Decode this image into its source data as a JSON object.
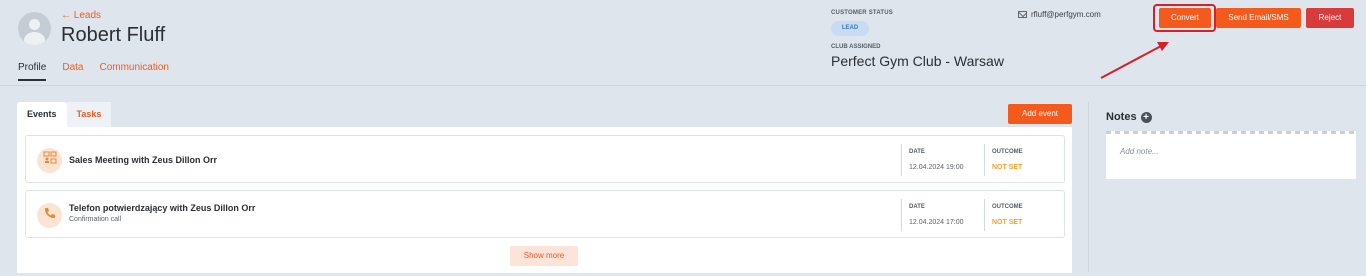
{
  "header": {
    "back_link": "← Leads",
    "name": "Robert Fluff",
    "tabs": [
      {
        "label": "Profile",
        "active": true
      },
      {
        "label": "Data",
        "active": false
      },
      {
        "label": "Communication",
        "active": false
      }
    ],
    "customer_status_label": "CUSTOMER STATUS",
    "customer_status_value": "LEAD",
    "club_assigned_label": "CLUB ASSIGNED",
    "club_name": "Perfect Gym Club - Warsaw",
    "email": "rfluff@perfgym.com",
    "buttons": {
      "convert": "Convert",
      "send_email": "Send Email/SMS",
      "reject": "Reject"
    }
  },
  "main": {
    "tabs": [
      {
        "label": "Events",
        "active": true
      },
      {
        "label": "Tasks",
        "active": false
      }
    ],
    "add_event_label": "Add event",
    "events": [
      {
        "title": "Sales Meeting with Zeus Dillon Orr",
        "subtitle": "",
        "icon": "meeting-icon",
        "date_label": "DATE",
        "date": "12.04.2024 19:00",
        "outcome_label": "OUTCOME",
        "outcome": "NOT SET"
      },
      {
        "title": "Telefon potwierdzający with Zeus Dillon Orr",
        "subtitle": "Confirmation call",
        "icon": "phone-icon",
        "date_label": "DATE",
        "date": "12.04.2024 17:00",
        "outcome_label": "OUTCOME",
        "outcome": "NOT SET"
      }
    ],
    "show_more_label": "Show more"
  },
  "notes": {
    "title": "Notes",
    "placeholder": "Add note..."
  },
  "colors": {
    "accent": "#f35a1c",
    "reject": "#d93a3a",
    "highlight": "#d6202a",
    "outcome": "#f0a12e"
  }
}
